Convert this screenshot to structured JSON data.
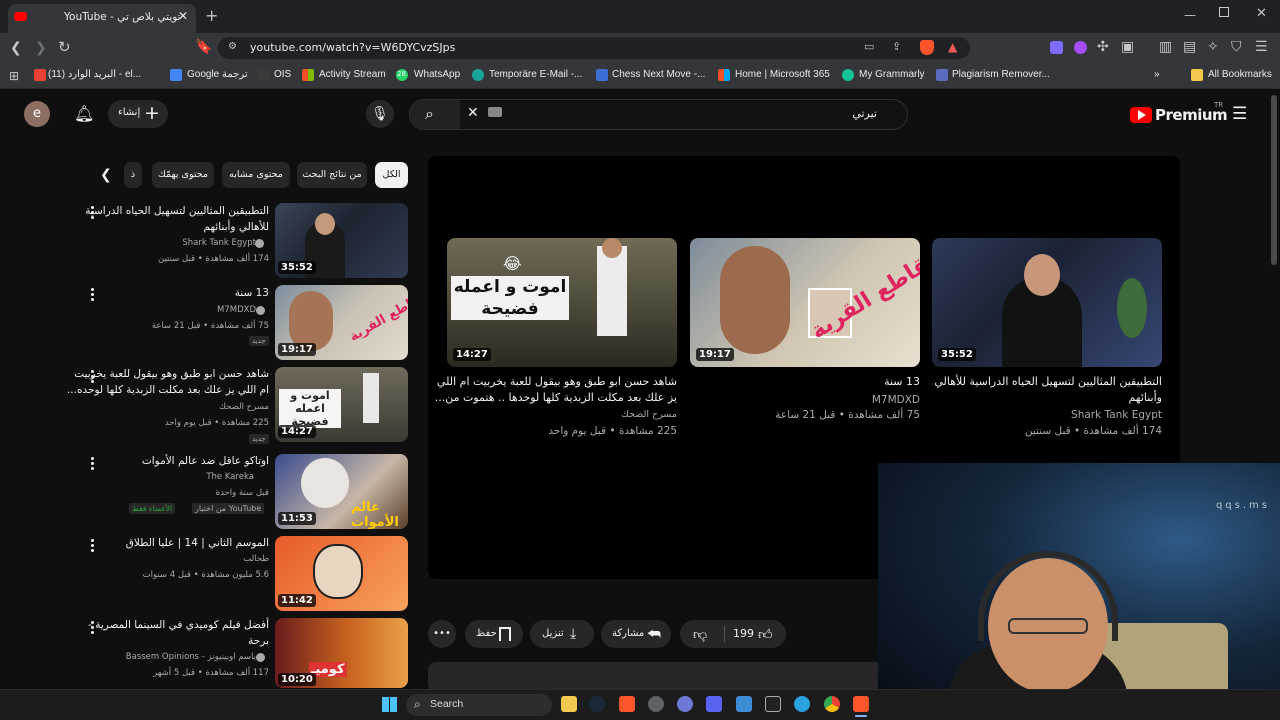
{
  "browser": {
    "tab_title": "YouTube - تويتي بلاص تي",
    "url": "youtube.com/watch?v=W6DYCvzSJps",
    "new_tab": "+",
    "bookmarks": [
      "البريد الوارد (11) - el...",
      "Google ترجمة",
      "OIS",
      "Activity Stream",
      "WhatsApp",
      "Temporäre E-Mail -...",
      "Chess Next Move -...",
      "Home | Microsoft 365",
      "My Grammarly",
      "Plagiarism Remover..."
    ],
    "all_bookmarks": "All Bookmarks",
    "whatsapp_badge": "28",
    "colors": {
      "tab_bg": "#35363a",
      "strip_bg": "#202124",
      "accent": "#8ab4f8"
    }
  },
  "youtube": {
    "logo_text": "Premium",
    "logo_region": "TR",
    "search_value": "تيرتي",
    "create_label": "إنشاء",
    "avatar_letter": "e",
    "chips": [
      "الكل",
      "من نتائج البحث",
      "محتوى مشابه",
      "محتوى يهمّك",
      "ذ"
    ],
    "player_grid": [
      {
        "title": "شاهد حسن ابو طبق وهو بيقول للعبة يخربيت ام اللي",
        "title2": "يز علك بعد مكلت الزبدية كلها لوحدها .. هتموت من...",
        "channel": "مسرح الضحك",
        "meta": "225 مشاهدة • قبل يوم واحد",
        "duration": "14:27",
        "thumb_text": "اموت و اعمله فضيحة"
      },
      {
        "title": "13 سنة",
        "title2": "",
        "channel": "M7MDXD",
        "meta": "75 ألف مشاهدة • قبل 21 ساعة",
        "duration": "19:17",
        "thumb_text": "مقاطع القرية"
      },
      {
        "title": "التطبيقين المثاليين لتسهيل الحياه الدراسية للأهالي",
        "title2": "وأبنائهم",
        "channel": "Shark Tank Egypt",
        "meta": "174 ألف مشاهدة • قبل سنتين",
        "duration": "35:52",
        "thumb_text": ""
      }
    ],
    "actions": {
      "likes": "199",
      "share": "مشاركة",
      "download": "تنزيل",
      "save": "حفظ",
      "more": "•••"
    },
    "sidebar": [
      {
        "title1": "التطبيقين المثاليين لتسهيل الحياه الدراسية",
        "title2": "للأهالي وأبنائهم",
        "channel": "Shark Tank Egypt",
        "meta": "174 ألف مشاهدة • قبل سنتين",
        "duration": "35:52",
        "badge": ""
      },
      {
        "title1": "13 سنة",
        "title2": "",
        "channel": "M7MDXD",
        "meta": "75 ألف مشاهدة • قبل 21 ساعة",
        "duration": "19:17",
        "badge": "جديد"
      },
      {
        "title1": "شاهد حسن ابو طبق وهو بيقول للعبة يخربيت",
        "title2": "ام اللي يز علك بعد مكلت الزبدية كلها لوحده...",
        "channel": "مسرح الضحك",
        "meta": "225 مشاهدة • قبل يوم واحد",
        "duration": "14:27",
        "badge": "جديد"
      },
      {
        "title1": "اوتاكو عاقل ضد عالم الأموات",
        "title2": "",
        "channel": "The Kareka",
        "meta": "قبل سنة واحدة",
        "duration": "11:53",
        "badge": "الأعضاء فقط",
        "extra": "من اختيار YouTube"
      },
      {
        "title1": "الموسم الثاني | 14 | عليا الطلاق",
        "title2": "",
        "channel": "طحالب",
        "meta": "5.6 مليون مشاهدة • قبل 4 سنوات",
        "duration": "11:42",
        "badge": ""
      },
      {
        "title1": "أفضل فيلم كوميدي في السينما المصرية -",
        "title2": "برحة",
        "channel": "Bassem Opinions - باسم اوبينيونز",
        "meta": "117 ألف مشاهدة • قبل 5 أشهر",
        "duration": "10:20",
        "badge": ""
      }
    ]
  },
  "overlay": {
    "watermark": "qqs.ms"
  },
  "taskbar": {
    "search": "Search"
  }
}
